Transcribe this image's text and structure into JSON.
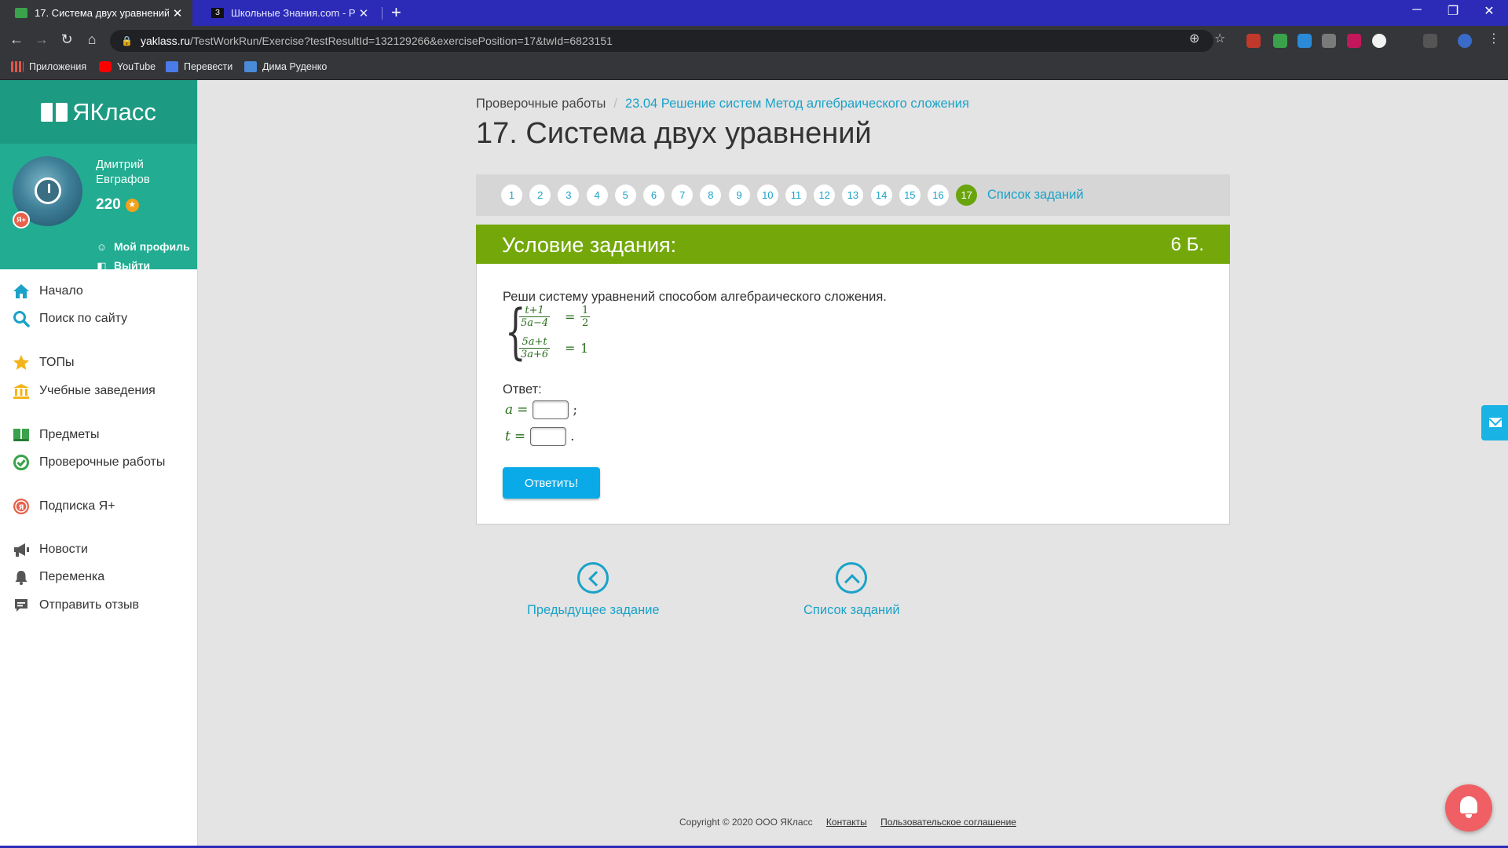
{
  "browser": {
    "tabs": [
      {
        "title": "17. Система двух уравнений",
        "active": true
      },
      {
        "title": "Школьные Знания.com - Решае",
        "active": false
      }
    ],
    "new_tab": "+",
    "close_glyph": "✕",
    "window_controls": {
      "minimize": "─",
      "restore": "❐",
      "close": "✕"
    },
    "nav": {
      "back": "←",
      "forward": "→",
      "reload": "↻",
      "home": "⌂"
    },
    "url_host": "yaklass.ru",
    "url_path": "/TestWorkRun/Exercise?testResultId=132129266&exercisePosition=17&twId=6823151",
    "url_lock": "🔒",
    "omni_icons": {
      "install": "⊕",
      "star": "☆",
      "menu": "⋮"
    },
    "bookmarks": [
      {
        "label": "Приложения",
        "icon": "apps-grid-icon",
        "color": "#e0574a"
      },
      {
        "label": "YouTube",
        "icon": "youtube-icon",
        "color": "#ff0000"
      },
      {
        "label": "Перевести",
        "icon": "translate-icon",
        "color": "#4a7be8"
      },
      {
        "label": "Дима Руденко",
        "icon": "chat-icon",
        "color": "#4a8ad8"
      }
    ]
  },
  "sidebar": {
    "logo": "ЯКласс",
    "user": {
      "first_name": "Дмитрий",
      "last_name": "Евграфов",
      "points": "220",
      "badge": "Я+",
      "profile_link": "Мой профиль",
      "logout_link": "Выйти"
    },
    "menu": [
      {
        "label": "Начало",
        "icon": "home-icon",
        "color": "#1aa2c8"
      },
      {
        "label": "Поиск по сайту",
        "icon": "search-icon",
        "color": "#1aa2c8"
      },
      {
        "label": "ТОПы",
        "icon": "star-icon",
        "color": "#f2b418"
      },
      {
        "label": "Учебные заведения",
        "icon": "institution-icon",
        "color": "#f2b418"
      },
      {
        "label": "Предметы",
        "icon": "books-icon",
        "color": "#3aa24a"
      },
      {
        "label": "Проверочные работы",
        "icon": "check-circle-icon",
        "color": "#3aa24a"
      },
      {
        "label": "Подписка Я+",
        "icon": "subscription-icon",
        "color": "#e8614a"
      },
      {
        "label": "Новости",
        "icon": "megaphone-icon",
        "color": "#555555"
      },
      {
        "label": "Переменка",
        "icon": "bell-icon",
        "color": "#555555"
      },
      {
        "label": "Отправить отзыв",
        "icon": "feedback-icon",
        "color": "#555555"
      }
    ]
  },
  "breadcrumb": {
    "root": "Проверочные работы",
    "separator": "/",
    "current": "23.04 Решение систем Метод алгебраического сложения"
  },
  "page_title": "17. Система двух уравнений",
  "pager": {
    "numbers": [
      "1",
      "2",
      "3",
      "4",
      "5",
      "6",
      "7",
      "8",
      "9",
      "10",
      "11",
      "12",
      "13",
      "14",
      "15",
      "16",
      "17"
    ],
    "current": "17",
    "list_link": "Список заданий"
  },
  "task": {
    "header": "Условие задания:",
    "points": "6 Б.",
    "statement": "Реши систему уравнений способом алгебраического сложения.",
    "equations": [
      {
        "num": "t+1",
        "den": "5a−4",
        "rhs_num": "1",
        "rhs_den": "2"
      },
      {
        "num": "5a+t",
        "den": "3a+6",
        "rhs": "1"
      }
    ],
    "equals_sign": "=",
    "answer_label": "Ответ:",
    "answers": [
      {
        "var": "a",
        "value": "",
        "punct": ";"
      },
      {
        "var": "t",
        "value": "",
        "punct": "."
      }
    ],
    "submit_label": "Ответить!"
  },
  "bottom_nav": {
    "prev_label": "Предыдущее задание",
    "list_label": "Список заданий"
  },
  "footer": {
    "copyright": "Copyright © 2020 ООО ЯКласс",
    "contacts": "Контакты",
    "agreement": "Пользовательское соглашение"
  },
  "colors": {
    "brand_green": "#22ac91",
    "task_header": "#74a80a",
    "link": "#1aa2c8",
    "button": "#0aaae8",
    "browser_tabstrip": "#2b2bb8"
  }
}
